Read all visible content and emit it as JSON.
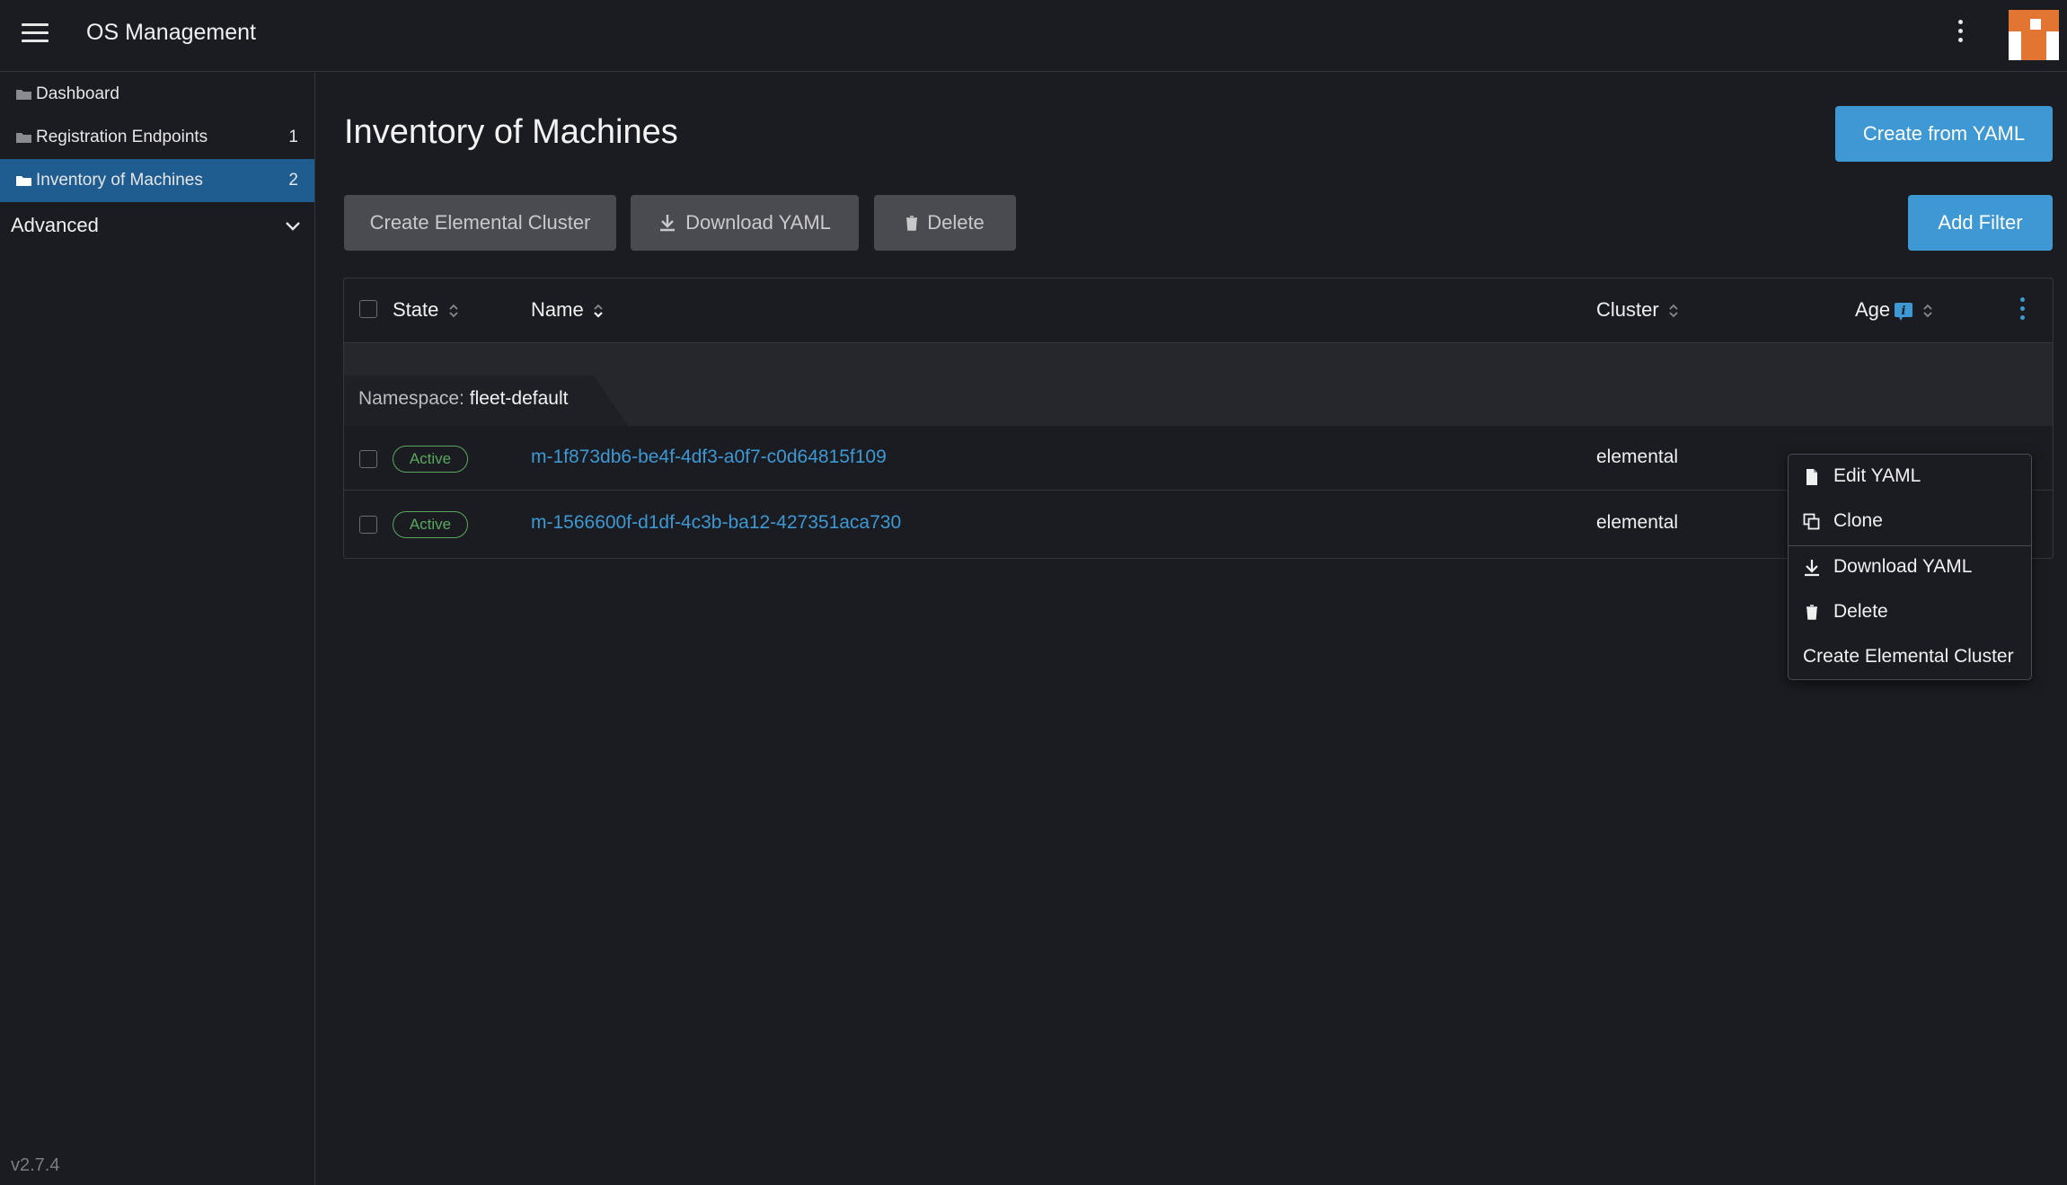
{
  "header": {
    "app_title": "OS Management",
    "menu_icon": "hamburger-menu-icon",
    "more_icon": "kebab-icon",
    "avatar_colors": {
      "bg": "#e27531",
      "fg": "#ffffff"
    }
  },
  "sidebar": {
    "items": [
      {
        "label": "Dashboard",
        "count": "",
        "icon": "folder-icon",
        "active": false
      },
      {
        "label": "Registration Endpoints",
        "count": "1",
        "icon": "folder-icon",
        "active": false
      },
      {
        "label": "Inventory of Machines",
        "count": "2",
        "icon": "folder-icon",
        "active": true
      }
    ],
    "advanced_label": "Advanced",
    "version": "v2.7.4"
  },
  "main": {
    "title": "Inventory of Machines",
    "create_from_yaml": "Create from YAML",
    "bulk_actions": {
      "create_cluster": "Create Elemental Cluster",
      "download_yaml": "Download YAML",
      "delete": "Delete"
    },
    "add_filter": "Add Filter",
    "table": {
      "columns": {
        "state": "State",
        "name": "Name",
        "cluster": "Cluster",
        "age": "Age"
      },
      "group": {
        "prefix": "Namespace:",
        "value": "fleet-default"
      },
      "rows": [
        {
          "state": "Active",
          "name": "m-1f873db6-be4f-4df3-a0f7-c0d64815f109",
          "cluster": "elemental"
        },
        {
          "state": "Active",
          "name": "m-1566600f-d1df-4c3b-ba12-427351aca730",
          "cluster": "elemental"
        }
      ]
    }
  },
  "context_menu": {
    "items": [
      {
        "label": "Edit YAML",
        "icon": "file-icon"
      },
      {
        "label": "Clone",
        "icon": "copy-icon"
      },
      {
        "label": "Download YAML",
        "icon": "download-icon"
      },
      {
        "label": "Delete",
        "icon": "trash-icon"
      },
      {
        "label": "Create Elemental Cluster",
        "icon": ""
      }
    ]
  },
  "colors": {
    "background": "#1b1c21",
    "accent": "#3d98d3",
    "active_nav": "#1f5c8f",
    "badge_active": "#5aa85f",
    "button_disabled": "#4a4b50"
  }
}
